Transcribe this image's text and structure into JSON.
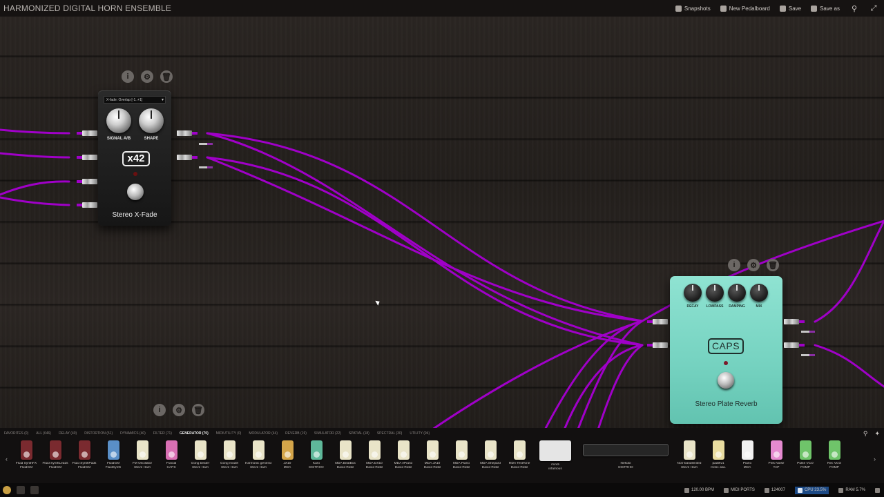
{
  "topbar": {
    "title": "HARMONIZED DIGITAL HORN ENSEMBLE",
    "actions": [
      {
        "label": "Snapshots",
        "icon": "camera-icon"
      },
      {
        "label": "New Pedalboard",
        "icon": "document-icon"
      },
      {
        "label": "Save",
        "icon": "save-icon"
      },
      {
        "label": "Save as",
        "icon": "save-as-icon"
      }
    ],
    "icons": [
      "search-icon",
      "fullscreen-icon"
    ]
  },
  "pedals": {
    "xfade": {
      "select": "X-fade: Overlap [-1..+1]",
      "knobs": [
        "SIGNAL A/B",
        "SHAPE"
      ],
      "logo": "x42",
      "name": "Stereo X-Fade",
      "color": "#1e1e1e"
    },
    "reverb": {
      "knobs": [
        "DECAY",
        "LOWPASS",
        "DAMPING",
        "MIX"
      ],
      "logo": "CAPS",
      "name": "Stereo Plate Reverb",
      "color": "#75d2c0"
    },
    "tools": [
      "info-icon",
      "settings-icon",
      "trash-icon"
    ]
  },
  "cable_color": "#a000c8",
  "dock": {
    "categories": [
      {
        "label": "FAVORITES (0)",
        "active": false
      },
      {
        "label": "ALL (646)",
        "active": false
      },
      {
        "label": "DELAY (40)",
        "active": false
      },
      {
        "label": "DISTORTION (51)",
        "active": false
      },
      {
        "label": "DYNAMICS (40)",
        "active": false
      },
      {
        "label": "FILTER (71)",
        "active": false
      },
      {
        "label": "GENERATOR (70)",
        "active": true
      },
      {
        "label": "MIDIUTILITY (0)",
        "active": false
      },
      {
        "label": "MODULATOR (44)",
        "active": false
      },
      {
        "label": "REVERB (19)",
        "active": false
      },
      {
        "label": "SIMULATOR (22)",
        "active": false
      },
      {
        "label": "SPATIAL (18)",
        "active": false
      },
      {
        "label": "SPECTRAL (30)",
        "active": false
      },
      {
        "label": "UTILITY (94)",
        "active": false
      }
    ],
    "plugins": [
      {
        "name": "Fluid SynthFX",
        "author": "FluidGM",
        "color": "#7a2a2f",
        "kind": "pedal"
      },
      {
        "name": "Fluid SynthLeads",
        "author": "FluidGM",
        "color": "#7a2a2f",
        "kind": "pedal"
      },
      {
        "name": "Fluid SynthPads",
        "author": "FluidGM",
        "color": "#7a2a2f",
        "kind": "pedal"
      },
      {
        "name": "FluidGM",
        "author": "FluidSynth",
        "color": "#5a8fc7",
        "kind": "pedal"
      },
      {
        "name": "FM Oscillator",
        "author": "Steve Harri",
        "color": "#e9e4c8",
        "kind": "pedal"
      },
      {
        "name": "Fractal",
        "author": "CAPS",
        "color": "#d86fb3",
        "kind": "pedal"
      },
      {
        "name": "Gong beater",
        "author": "Steve Harri",
        "color": "#e9e4c8",
        "kind": "pedal"
      },
      {
        "name": "Gong model",
        "author": "Steve Harri",
        "color": "#e9e4c8",
        "kind": "pedal"
      },
      {
        "name": "Harmonic generat",
        "author": "Steve Harri",
        "color": "#e9e4c8",
        "kind": "pedal"
      },
      {
        "name": "JX10",
        "author": "MDA",
        "color": "#d4a54a",
        "kind": "pedal"
      },
      {
        "name": "Karo",
        "author": "DISTRHO",
        "color": "#5fb89a",
        "kind": "pedal"
      },
      {
        "name": "MDA BeatBox",
        "author": "David Robil",
        "color": "#e9e4c8",
        "kind": "pedal"
      },
      {
        "name": "MDA DX10",
        "author": "David Robil",
        "color": "#e9e4c8",
        "kind": "pedal"
      },
      {
        "name": "MDA ePiano",
        "author": "David Robil",
        "color": "#e9e4c8",
        "kind": "pedal"
      },
      {
        "name": "MDA JX10",
        "author": "David Robil",
        "color": "#e9e4c8",
        "kind": "pedal"
      },
      {
        "name": "MDA Piano",
        "author": "David Robil",
        "color": "#e9e4c8",
        "kind": "pedal"
      },
      {
        "name": "MDA Shepard",
        "author": "David Robil",
        "color": "#e9e4c8",
        "kind": "pedal"
      },
      {
        "name": "MDA TestTone",
        "author": "David Robil",
        "color": "#e9e4c8",
        "kind": "pedal"
      },
      {
        "name": "mindi",
        "author": "infamous",
        "color": "#e5e5e5",
        "kind": "wide"
      },
      {
        "name": "Nekobi",
        "author": "DISTRHO",
        "color": "#262626",
        "kind": "rack"
      },
      {
        "name": "Non-bandlimited",
        "author": "Steve Harri",
        "color": "#e9e4c8",
        "kind": "pedal"
      },
      {
        "name": "padthv1",
        "author": "rncbc aka.",
        "color": "#e9dca0",
        "kind": "pedal"
      },
      {
        "name": "Piano",
        "author": "MDA",
        "color": "#f1f1f1",
        "kind": "pedal"
      },
      {
        "name": "Pink Noise",
        "author": "TAP",
        "color": "#e58ad0",
        "kind": "pedal"
      },
      {
        "name": "Pulse VCO",
        "author": "FOMP",
        "color": "#6fc46a",
        "kind": "pedal"
      },
      {
        "name": "Rec VCO",
        "author": "FOMP",
        "color": "#6fc46a",
        "kind": "pedal"
      }
    ]
  },
  "statusbar": {
    "bpm": "120.00 BPM",
    "midi": "MIDI PORTS",
    "buffer": "124007",
    "cpu": "CPU 23.5%",
    "ram": "RAM 5.7%"
  }
}
